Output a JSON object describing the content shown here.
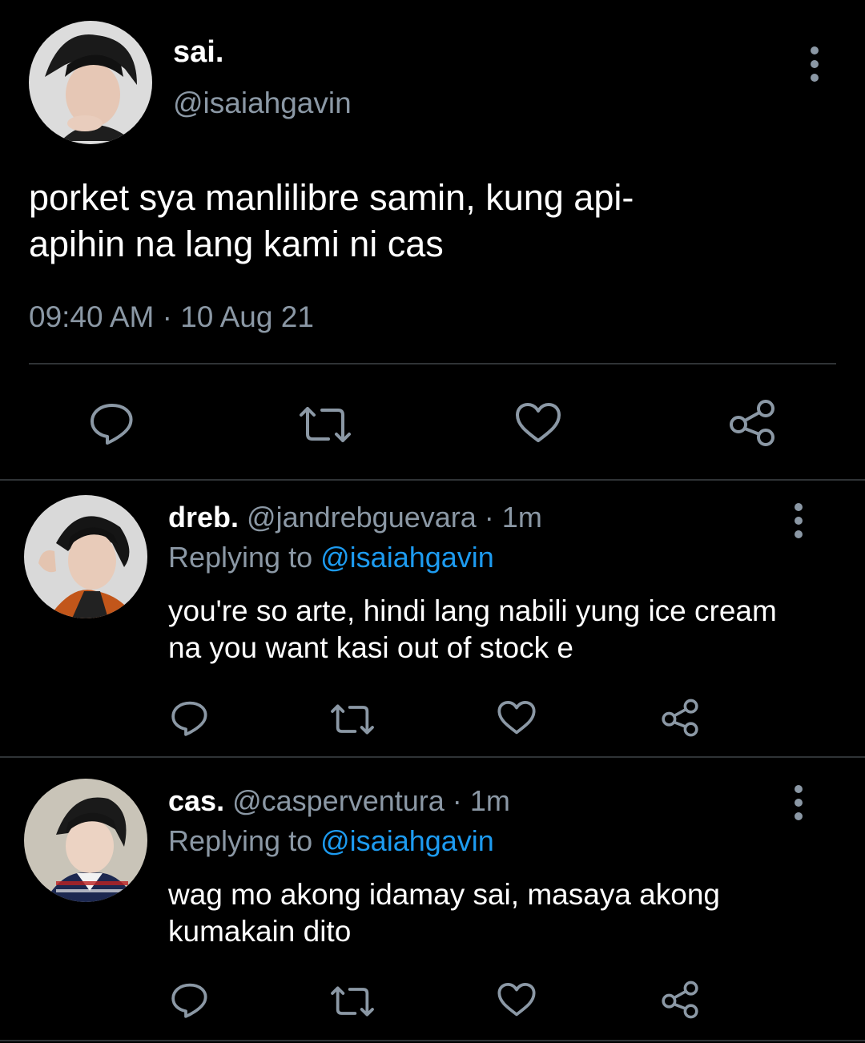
{
  "main_tweet": {
    "name": "sai.",
    "handle": "@isaiahgavin",
    "text": "porket sya manlilibre samin, kung api-\napihin na lang kami ni cas",
    "time": "09:40 AM",
    "separator": "·",
    "date": "10 Aug 21"
  },
  "replies": [
    {
      "name": "dreb.",
      "handle": "@jandrebguevara",
      "dot": "·",
      "time": "1m",
      "replying_prefix": "Replying to",
      "replying_to": "@isaiahgavin",
      "text": "you're so arte, hindi lang nabili yung ice cream na you want kasi out of stock e"
    },
    {
      "name": "cas.",
      "handle": "@casperventura",
      "dot": "·",
      "time": "1m",
      "replying_prefix": "Replying to",
      "replying_to": "@isaiahgavin",
      "text": "wag mo akong idamay sai, masaya akong kumakain dito"
    }
  ],
  "icons": {
    "reply": "reply-icon",
    "retweet": "retweet-icon",
    "like": "heart-icon",
    "share": "share-icon",
    "more": "more-vertical-icon"
  },
  "colors": {
    "background": "#000000",
    "text": "#ffffff",
    "muted": "#8b98a5",
    "link": "#1d9bf0",
    "divider": "#2f3336"
  }
}
